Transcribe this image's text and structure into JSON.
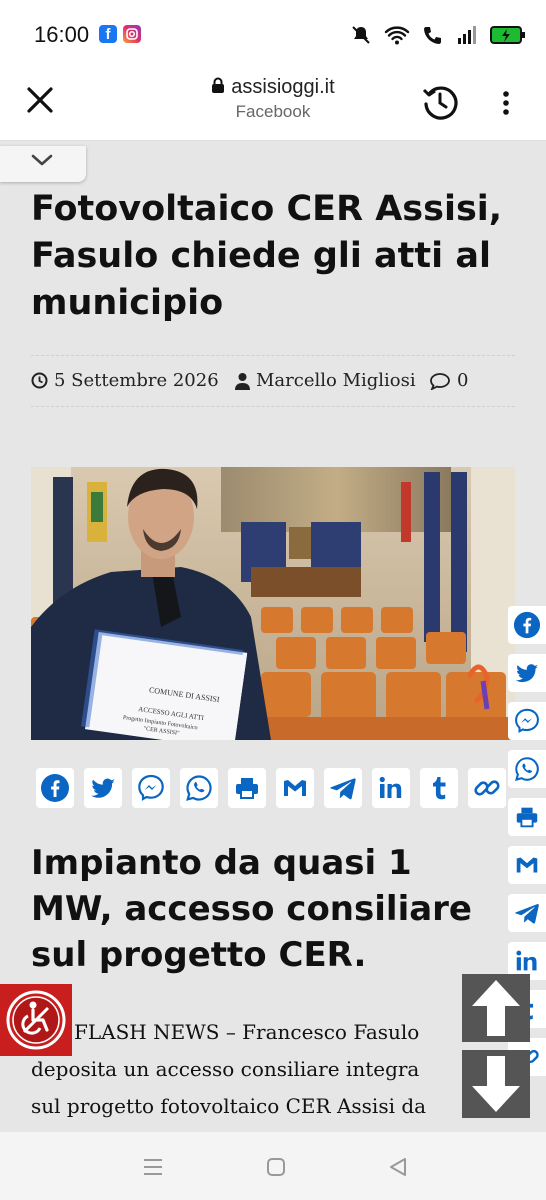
{
  "status_bar": {
    "time": "16:00",
    "icons": [
      "facebook-app-icon",
      "instagram-app-icon",
      "mute-icon",
      "wifi-icon",
      "wifi-call-icon",
      "signal-icon",
      "battery-charging-icon"
    ]
  },
  "browser": {
    "domain": "assisioggi.it",
    "source": "Facebook",
    "icons": [
      "close-icon",
      "lock-icon",
      "history-icon",
      "more-vert-icon"
    ]
  },
  "article": {
    "title": "Fotovoltaico CER Assisi, Fasulo chiede gli atti al municipio",
    "date": "5 Settembre 2026",
    "author": "Marcello Migliosi",
    "comments_count": "0",
    "image_alt": "Francesco Fasulo nella sala consiliare con documenti",
    "document_text": {
      "comune": "COMUNE DI ASSISI",
      "accesso": "ACCESSO AGLI ATTI",
      "progetto": "Progetto Impianto Fotovoltaico",
      "cer": "\"CER ASSISI\""
    },
    "subtitle": "Impianto da quasi 1 MW, accesso consiliare sul progetto CER.",
    "body_lead": "FLASH NEWS – Francesco Fasulo",
    "body_line2": "deposita un accesso consiliare integra",
    "body_line3": "sul progetto fotovoltaico CER Assisi da"
  },
  "share_inline": [
    "Facebook",
    "Twitter",
    "Messenger",
    "WhatsApp",
    "Print",
    "Gmail",
    "Telegram",
    "LinkedIn",
    "Tumblr",
    "Copy Link"
  ],
  "share_side": [
    "Facebook",
    "Twitter",
    "Messenger",
    "WhatsApp",
    "Print",
    "Gmail",
    "Telegram",
    "LinkedIn",
    "Tumblr",
    "Copy Link"
  ],
  "colors": {
    "share_blue": "#0a66c2",
    "accessibility_red": "#c81e1e",
    "page_bg": "#e6e6e6"
  }
}
